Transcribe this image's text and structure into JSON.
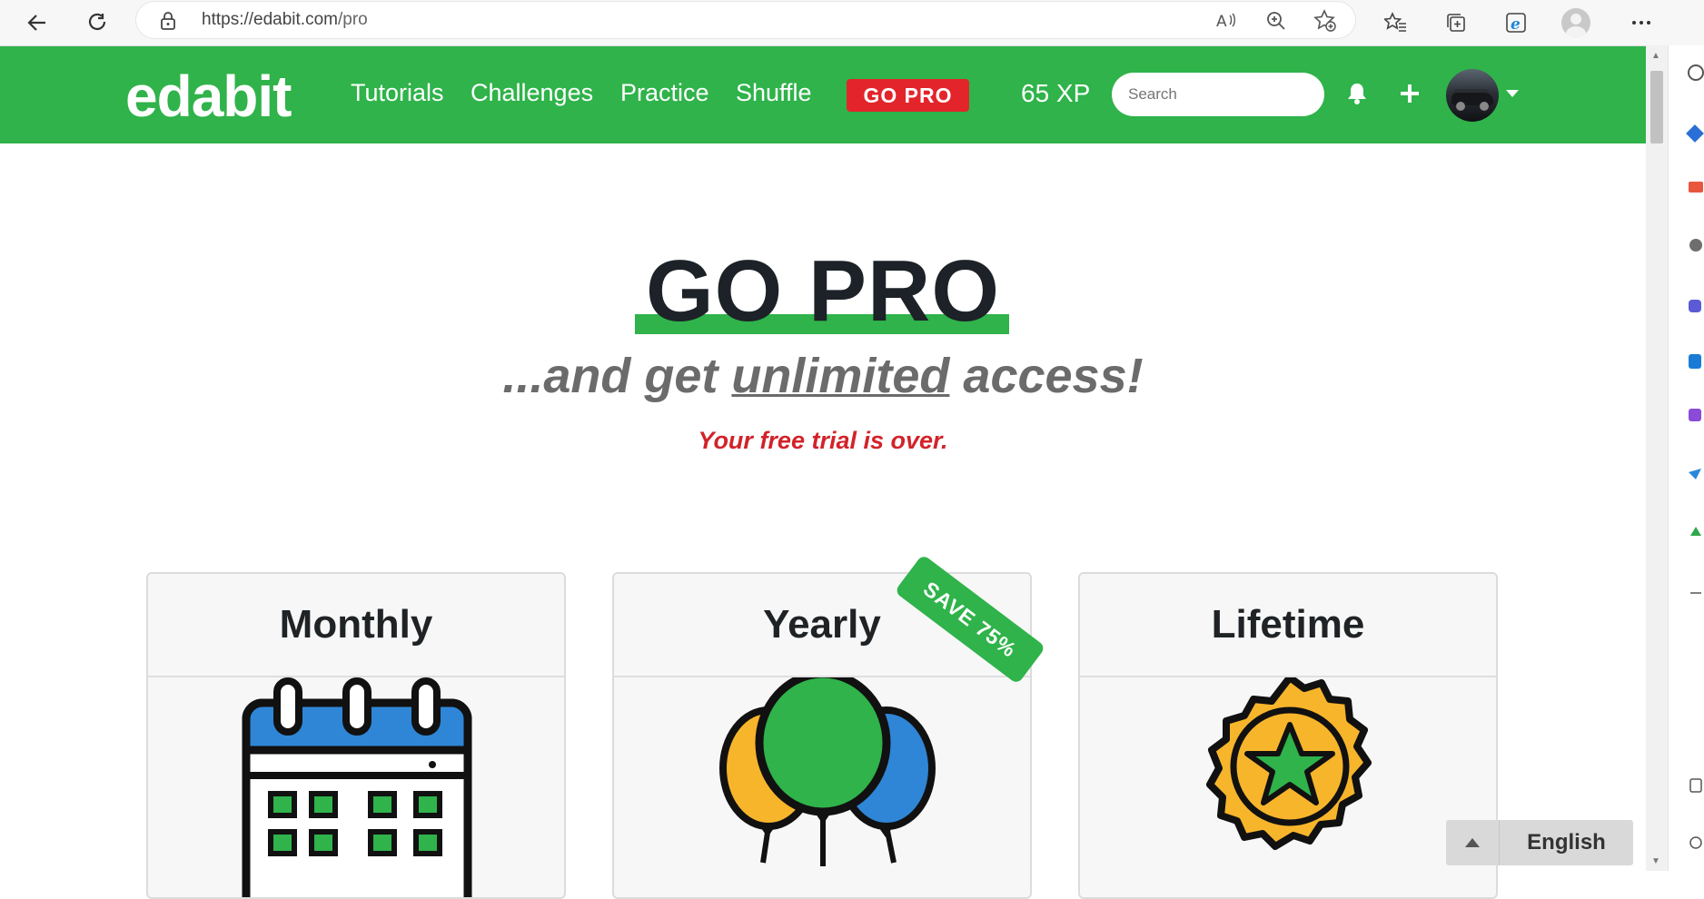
{
  "browser": {
    "url_host": "https://edabit.com",
    "url_path": "/pro"
  },
  "header": {
    "logo": "edabit",
    "nav": [
      "Tutorials",
      "Challenges",
      "Practice",
      "Shuffle"
    ],
    "go_pro": "GO PRO",
    "xp": "65 XP",
    "search_placeholder": "Search",
    "brand_color": "#2fb34a",
    "accent_color": "#e3242b"
  },
  "hero": {
    "title": "GO PRO",
    "subtitle_before": "...and get ",
    "subtitle_emph": "unlimited",
    "subtitle_after": " access!",
    "trial_notice": "Your free trial is over."
  },
  "plans": [
    {
      "name": "Monthly",
      "icon": "calendar-icon"
    },
    {
      "name": "Yearly",
      "icon": "balloons-icon",
      "badge": "SAVE 75%"
    },
    {
      "name": "Lifetime",
      "icon": "medal-star-icon"
    }
  ],
  "footer": {
    "language": "English"
  }
}
